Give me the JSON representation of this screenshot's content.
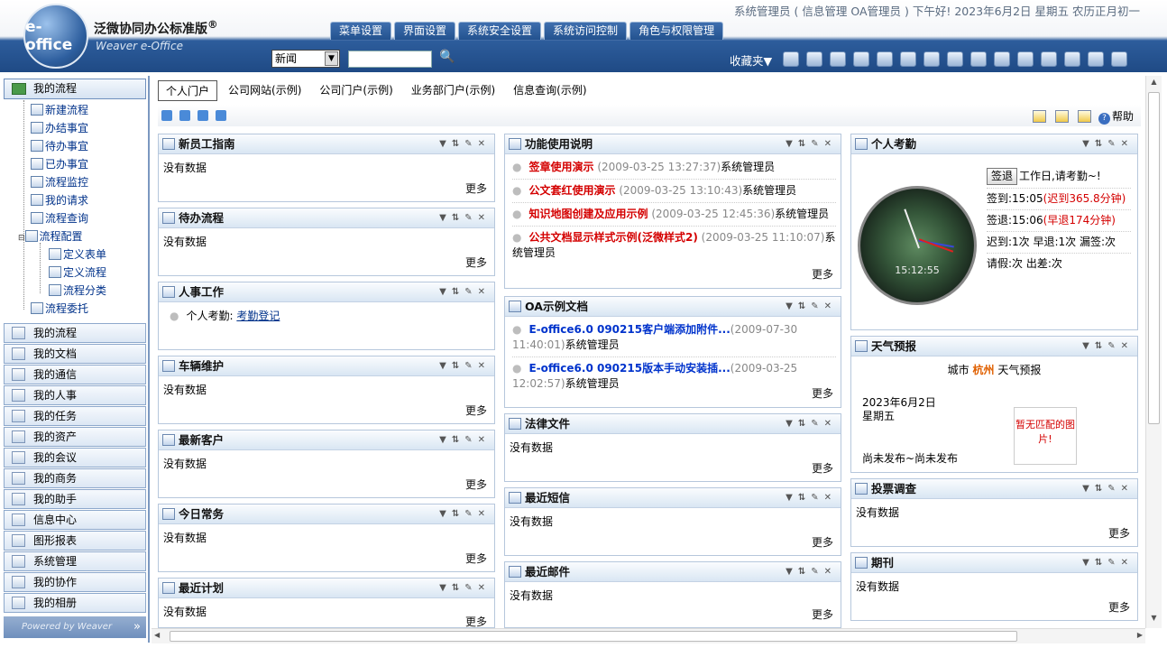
{
  "header": {
    "status": "系统管理员 ( 信息管理 OA管理员 ) 下午好! 2023年6月2日 星期五 农历正月初一",
    "logo_text": "e-office",
    "brand_cn": "泛微协同办公标准版",
    "reg_mark": "®",
    "brand_en": "Weaver e-Office",
    "nav_tabs": [
      "菜单设置",
      "界面设置",
      "系统安全设置",
      "系统访问控制",
      "角色与权限管理"
    ],
    "search_select": "新闻",
    "search_value": "",
    "favorites": "收藏夹▼"
  },
  "sidebar": {
    "head": "我的流程",
    "tree": [
      "新建流程",
      "办结事宜",
      "待办事宜",
      "已办事宜",
      "流程监控",
      "我的请求",
      "流程查询",
      "流程配置",
      "定义表单",
      "定义流程",
      "流程分类",
      "流程委托"
    ],
    "menu": [
      "我的流程",
      "我的文档",
      "我的通信",
      "我的人事",
      "我的任务",
      "我的资产",
      "我的会议",
      "我的商务",
      "我的助手",
      "信息中心",
      "图形报表",
      "系统管理",
      "我的协作",
      "我的相册"
    ],
    "footer": "Powered by Weaver",
    "collapse": "»"
  },
  "portal": {
    "tabs": [
      "个人门户",
      "公司网站(示例)",
      "公司门户(示例)",
      "业务部门户(示例)",
      "信息查询(示例)"
    ],
    "help": "帮助"
  },
  "portlets": {
    "new_staff": {
      "title": "新员工指南",
      "body": "没有数据",
      "more": "更多"
    },
    "todo": {
      "title": "待办流程",
      "body": "没有数据",
      "more": "更多"
    },
    "hr": {
      "title": "人事工作",
      "label": "个人考勤:",
      "link": "考勤登记"
    },
    "vehicle": {
      "title": "车辆维护",
      "body": "没有数据",
      "more": "更多"
    },
    "customer": {
      "title": "最新客户",
      "body": "没有数据",
      "more": "更多"
    },
    "today": {
      "title": "今日常务",
      "body": "没有数据",
      "more": "更多"
    },
    "plan": {
      "title": "最近计划",
      "body": "没有数据",
      "more": "更多"
    },
    "feature": {
      "title": "功能使用说明",
      "more": "更多",
      "items": [
        {
          "title": "签章使用演示",
          "time": "(2009-03-25 13:27:37)",
          "author": "系统管理员"
        },
        {
          "title": "公文套红使用演示",
          "time": "(2009-03-25 13:10:43)",
          "author": "系统管理员"
        },
        {
          "title": "知识地图创建及应用示例",
          "time": "(2009-03-25 12:45:36)",
          "author": "系统管理员"
        },
        {
          "title": "公共文档显示样式示例(泛微样式2)",
          "time": "(2009-03-25 11:10:07)",
          "author": "系统管理员"
        }
      ]
    },
    "oa_docs": {
      "title": "OA示例文档",
      "more": "更多",
      "items": [
        {
          "title": "E-office6.0 090215客户端添加附件...",
          "time": "(2009-07-30 11:40:01)",
          "author": "系统管理员"
        },
        {
          "title": "E-office6.0 090215版本手动安装插...",
          "time": "(2009-03-25 12:02:57)",
          "author": "系统管理员"
        }
      ]
    },
    "law": {
      "title": "法律文件",
      "body": "没有数据",
      "more": "更多"
    },
    "sms": {
      "title": "最近短信",
      "body": "没有数据",
      "more": "更多"
    },
    "mail": {
      "title": "最近邮件",
      "body": "没有数据",
      "more": "更多"
    },
    "attendance": {
      "title": "个人考勤",
      "clock_time": "15:12:55",
      "sign_btn": "签退",
      "workday": "工作日,请考勤~!",
      "signin": "签到:15:05",
      "signin_late": "(迟到365.8分钟)",
      "signout": "签退:15:06",
      "signout_early": "(早退174分钟)",
      "late_count": "迟到:1次 早退:1次 漏签:次",
      "leave": "请假:次 出差:次"
    },
    "weather": {
      "title": "天气预报",
      "city_label": "城市",
      "city": "杭州",
      "suffix": "天气预报",
      "date": "2023年6月2日",
      "weekday": "星期五",
      "no_img": "暂无匹配的图片!",
      "notice": "尚未发布~尚未发布"
    },
    "vote": {
      "title": "投票调查",
      "body": "没有数据",
      "more": "更多"
    },
    "journal": {
      "title": "期刊",
      "body": "没有数据",
      "more": "更多"
    }
  }
}
